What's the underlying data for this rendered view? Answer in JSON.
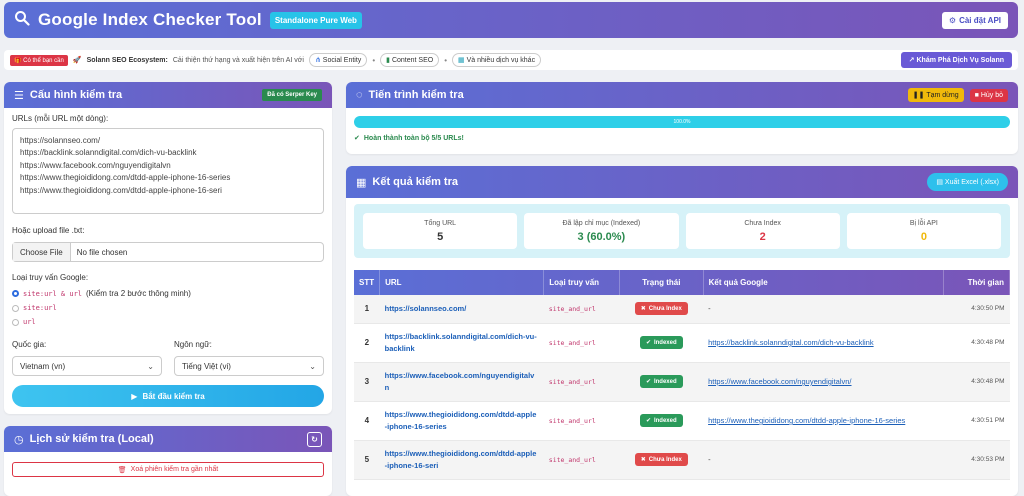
{
  "header": {
    "title": "Google Index Checker Tool",
    "badge": "Standalone Pure Web",
    "api_button": "Cài đặt API",
    "colors": {
      "gradient_start": "#5a6fd6",
      "gradient_end": "#7a55b8"
    }
  },
  "ecosystem": {
    "tag": "Có thể bạn cần",
    "brand": "Solann SEO Ecosystem:",
    "desc": "Cải thiện thứ hạng và xuất hiện trên AI với",
    "pills": [
      "Social Entity",
      "Content SEO",
      "Và nhiều dịch vụ khác"
    ],
    "explore_button": "Khám Phá Dịch Vụ Solann"
  },
  "config": {
    "title": "Cấu hình kiểm tra",
    "key_tag": "Đã có Serper Key",
    "urls_label": "URLs (mỗi URL một dòng):",
    "urls_value": "https://solannseo.com/\nhttps://backlink.solanndigital.com/dich-vu-backlink\nhttps://www.facebook.com/nguyendigitalvn\nhttps://www.thegioididong.com/dtdd-apple-iphone-16-series\nhttps://www.thegioididong.com/dtdd-apple-iphone-16-seri",
    "upload_label": "Hoặc upload file .txt:",
    "choose_file": "Choose File",
    "no_file": "No file chosen",
    "query_label": "Loại truy vấn Google:",
    "query_options": [
      {
        "code": "site:url & url",
        "desc": "(Kiểm tra 2 bước thông minh)"
      },
      {
        "code": "site:url",
        "desc": ""
      },
      {
        "code": "url",
        "desc": ""
      }
    ],
    "country_label": "Quốc gia:",
    "country_value": "Vietnam (vn)",
    "language_label": "Ngôn ngữ:",
    "language_value": "Tiếng Việt (vi)",
    "start_button": "Bắt đầu kiểm tra"
  },
  "history": {
    "title": "Lịch sử kiểm tra (Local)",
    "clear_button": "Xoá phiên kiểm tra gần nhất"
  },
  "progress": {
    "title": "Tiến trình kiểm tra",
    "pause_button": "Tạm dừng",
    "cancel_button": "Hủy bỏ",
    "percent": 100,
    "percent_label": "100.0%",
    "status": "Hoàn thành toàn bộ 5/5 URLs!",
    "bar_color": "#2ecfe8"
  },
  "results": {
    "title": "Kết quả kiểm tra",
    "export_button": "Xuất Excel (.xlsx)",
    "stats": [
      {
        "label": "Tổng URL",
        "value": "5",
        "color": "#333333"
      },
      {
        "label": "Đã lập chỉ mục (Indexed)",
        "value": "3 (60.0%)",
        "color": "#2a8a4e"
      },
      {
        "label": "Chưa Index",
        "value": "2",
        "color": "#dc3545"
      },
      {
        "label": "Bị lỗi API",
        "value": "0",
        "color": "#f0b90b"
      }
    ],
    "columns": [
      "STT",
      "URL",
      "Loại truy vấn",
      "Trạng thái",
      "Kết quả Google",
      "Thời gian"
    ],
    "rows": [
      {
        "stt": "1",
        "url": "https://solannseo.com/",
        "query": "site_and_url",
        "status": "Chưa Index",
        "ok": false,
        "result": "-",
        "time": "4:30:50 PM"
      },
      {
        "stt": "2",
        "url": "https://backlink.solanndigital.com/dich-vu-backlink",
        "query": "site_and_url",
        "status": "Indexed",
        "ok": true,
        "result": "https://backlink.solanndigital.com/dich-vu-backlink",
        "time": "4:30:48 PM"
      },
      {
        "stt": "3",
        "url": "https://www.facebook.com/nguyendigitalvn",
        "query": "site_and_url",
        "status": "Indexed",
        "ok": true,
        "result": "https://www.facebook.com/nguyendigitalvn/",
        "time": "4:30:48 PM"
      },
      {
        "stt": "4",
        "url": "https://www.thegioididong.com/dtdd-apple-iphone-16-series",
        "query": "site_and_url",
        "status": "Indexed",
        "ok": true,
        "result": "https://www.thegioididong.com/dtdd-apple-iphone-16-series",
        "time": "4:30:51 PM"
      },
      {
        "stt": "5",
        "url": "https://www.thegioididong.com/dtdd-apple-iphone-16-seri",
        "query": "site_and_url",
        "status": "Chưa Index",
        "ok": false,
        "result": "-",
        "time": "4:30:53 PM"
      }
    ]
  }
}
